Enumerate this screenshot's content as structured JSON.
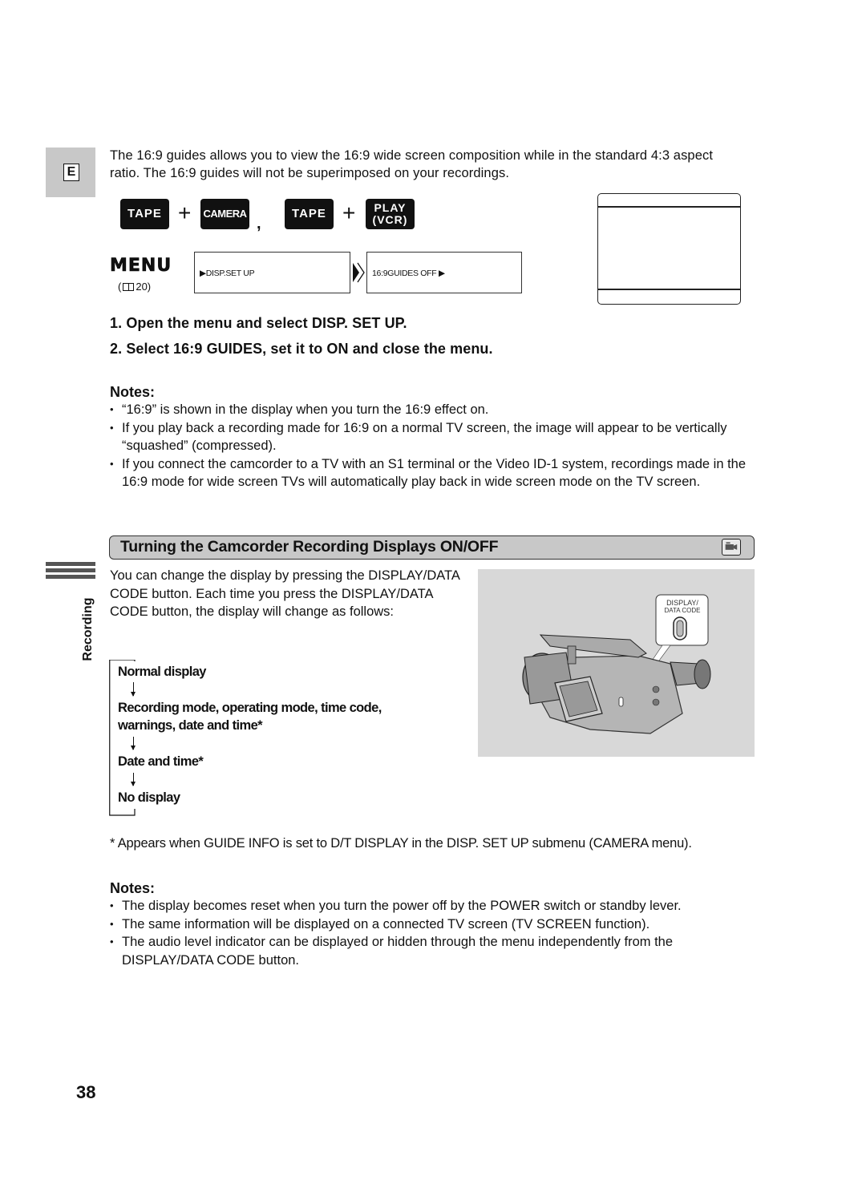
{
  "language_tab": "E",
  "intro": "The 16:9 guides allows you to view the 16:9 wide screen composition while in the standard 4:3 aspect ratio. The 16:9 guides will not be superimposed on your recordings.",
  "keys": {
    "group1": [
      "TAPE",
      "CAMERA"
    ],
    "group2": [
      "TAPE",
      "PLAY",
      "(VCR)"
    ],
    "plus": "+",
    "separator": ","
  },
  "menu": {
    "label": "MENU",
    "ref_open": "(",
    "ref_page": "20)",
    "lcd1": "▶DISP.SET UP",
    "lcd2": "16:9GUIDES   OFF  ▶"
  },
  "steps": [
    "1.  Open the menu and select DISP. SET UP.",
    "2.  Select 16:9 GUIDES, set it to ON and close the menu."
  ],
  "notes1": {
    "heading": "Notes:",
    "items": [
      "“16:9” is shown in the display when you turn the 16:9 effect on.",
      "If you play back a recording made for 16:9 on a normal TV screen, the image will appear to be vertically “squashed” (compressed).",
      "If you connect the camcorder to a TV with an S1 terminal or the Video ID-1 system, recordings made in the 16:9 mode for wide screen TVs will automatically play back in wide screen mode on the TV screen."
    ]
  },
  "section": {
    "title": "Turning the Camcorder Recording Displays ON/OFF",
    "icon": "camera-mode-icon"
  },
  "side_label": "Recording",
  "body": "You can change the display by pressing the DISPLAY/DATA CODE button. Each time you press the DISPLAY/DATA CODE button, the display will change as follows:",
  "flow": [
    "Normal display",
    "Recording mode, operating mode, time code,",
    "warnings, date and time*",
    "Date and time*",
    "No display"
  ],
  "photo": {
    "callout_line1": "DISPLAY/",
    "callout_line2": "DATA CODE"
  },
  "footnote": "*  Appears when GUIDE INFO is set to D/T DISPLAY in the DISP. SET UP submenu (CAMERA menu).",
  "notes2": {
    "heading": "Notes:",
    "items": [
      "The display becomes reset when you turn the power off by the POWER switch or standby lever.",
      "The same information will be displayed on a connected TV screen (TV SCREEN function).",
      "The audio level indicator can be displayed or hidden through the menu independently from the DISPLAY/DATA CODE button."
    ]
  },
  "page_number": "38"
}
